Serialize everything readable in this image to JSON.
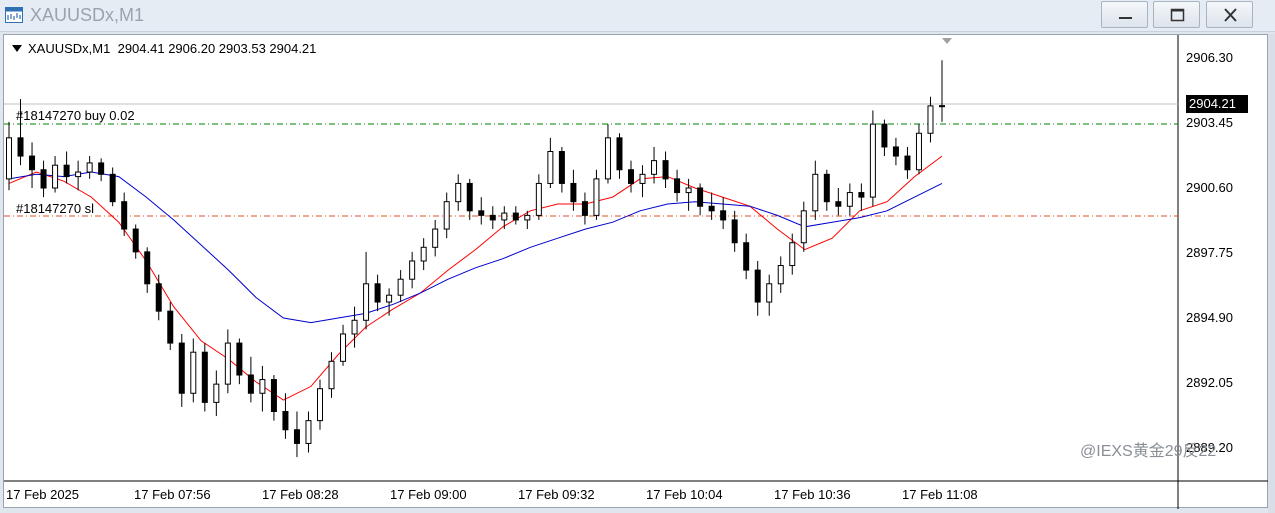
{
  "window": {
    "title": "XAUUSDx,M1",
    "app_icon": "chart-window-icon",
    "buttons": {
      "minimize": "minimize-icon",
      "maximize": "maximize-icon",
      "close": "close-icon"
    }
  },
  "header": {
    "symbol": "XAUUSDx,M1",
    "ohlc": "2904.41 2906.20 2903.53 2904.21"
  },
  "orders": {
    "buy": {
      "label": "#18147270 buy 0.02",
      "price": 2903.3,
      "color": "#008000"
    },
    "sl": {
      "label": "#18147270 sl",
      "price": 2899.0,
      "color": "#e0522a"
    }
  },
  "current_price": {
    "label": "2904.21",
    "value": 2904.21
  },
  "price_axis": [
    "2906.30",
    "2903.45",
    "2900.60",
    "2897.75",
    "2894.90",
    "2892.05",
    "2889.20"
  ],
  "time_axis": [
    "17 Feb 2025",
    "17 Feb 07:56",
    "17 Feb 08:28",
    "17 Feb 09:00",
    "17 Feb 09:32",
    "17 Feb 10:04",
    "17 Feb 10:36",
    "17 Feb 11:08"
  ],
  "watermark": "@IEXS黄金29反22",
  "colors": {
    "bull": "#ffffff",
    "bear": "#000000",
    "fast_ma": "#ff0000",
    "slow_ma": "#0000cc",
    "grid": "#c0c0c0"
  },
  "chart_data": {
    "type": "candlestick",
    "timeframe": "M1",
    "ylim": [
      2888.3,
      2907.2
    ],
    "moving_averages": [
      {
        "color": "#ff0000",
        "values": [
          2900.8,
          2901.3,
          2900.9,
          2900.2,
          2899.1,
          2897.4,
          2895.4,
          2893.9,
          2893.1,
          2892.1,
          2891.3,
          2891.9,
          2893.3,
          2894.5,
          2895.3,
          2896.0,
          2897.0,
          2897.9,
          2898.9,
          2899.6,
          2899.9,
          2899.9,
          2900.2,
          2901.0,
          2901.1,
          2900.6,
          2900.2,
          2899.8,
          2898.8,
          2897.9,
          2898.4,
          2899.6,
          2900.0,
          2901.1,
          2902.0
        ]
      },
      {
        "color": "#0000cc",
        "values": [
          2901.0,
          2901.2,
          2901.1,
          2901.3,
          2901.1,
          2900.2,
          2899.2,
          2898.1,
          2897.0,
          2895.8,
          2894.9,
          2894.7,
          2894.9,
          2895.1,
          2895.5,
          2896.0,
          2896.6,
          2897.1,
          2897.5,
          2898.0,
          2898.4,
          2898.8,
          2899.1,
          2899.6,
          2899.9,
          2900.0,
          2899.9,
          2899.8,
          2899.4,
          2898.9,
          2899.1,
          2899.3,
          2899.6,
          2900.2,
          2900.8
        ]
      }
    ],
    "candles": [
      [
        2901.0,
        2903.5,
        2900.5,
        2902.8
      ],
      [
        2902.8,
        2904.5,
        2901.6,
        2902.0
      ],
      [
        2902.0,
        2902.6,
        2900.6,
        2901.4
      ],
      [
        2901.4,
        2901.8,
        2900.2,
        2900.6
      ],
      [
        2900.6,
        2902.0,
        2900.4,
        2901.6
      ],
      [
        2901.6,
        2902.2,
        2900.8,
        2901.1
      ],
      [
        2901.1,
        2901.8,
        2900.5,
        2901.3
      ],
      [
        2901.3,
        2902.0,
        2901.0,
        2901.7
      ],
      [
        2901.7,
        2901.9,
        2900.9,
        2901.2
      ],
      [
        2901.2,
        2901.5,
        2899.8,
        2900.0
      ],
      [
        2900.0,
        2900.4,
        2898.5,
        2898.8
      ],
      [
        2898.8,
        2899.0,
        2897.5,
        2897.8
      ],
      [
        2897.8,
        2898.0,
        2896.0,
        2896.4
      ],
      [
        2896.4,
        2896.8,
        2894.8,
        2895.2
      ],
      [
        2895.2,
        2895.6,
        2893.5,
        2893.8
      ],
      [
        2893.8,
        2894.2,
        2891.0,
        2891.6
      ],
      [
        2891.6,
        2894.0,
        2891.2,
        2893.4
      ],
      [
        2893.4,
        2893.8,
        2890.8,
        2891.2
      ],
      [
        2891.2,
        2892.6,
        2890.6,
        2892.0
      ],
      [
        2892.0,
        2894.4,
        2891.6,
        2893.8
      ],
      [
        2893.8,
        2894.0,
        2892.0,
        2892.4
      ],
      [
        2892.4,
        2893.2,
        2891.2,
        2891.6
      ],
      [
        2891.6,
        2892.8,
        2890.8,
        2892.2
      ],
      [
        2892.2,
        2892.4,
        2890.4,
        2890.8
      ],
      [
        2890.8,
        2891.6,
        2889.6,
        2890.0
      ],
      [
        2890.0,
        2890.8,
        2888.8,
        2889.4
      ],
      [
        2889.4,
        2890.8,
        2889.0,
        2890.4
      ],
      [
        2890.4,
        2892.2,
        2890.0,
        2891.8
      ],
      [
        2891.8,
        2893.4,
        2891.4,
        2893.0
      ],
      [
        2893.0,
        2894.6,
        2892.8,
        2894.2
      ],
      [
        2894.2,
        2895.4,
        2893.6,
        2894.8
      ],
      [
        2894.8,
        2897.8,
        2894.4,
        2896.4
      ],
      [
        2896.4,
        2896.8,
        2895.2,
        2895.6
      ],
      [
        2895.6,
        2896.2,
        2895.0,
        2895.9
      ],
      [
        2895.9,
        2897.0,
        2895.6,
        2896.6
      ],
      [
        2896.6,
        2897.8,
        2896.2,
        2897.4
      ],
      [
        2897.4,
        2898.4,
        2897.0,
        2898.0
      ],
      [
        2898.0,
        2899.2,
        2897.6,
        2898.8
      ],
      [
        2898.8,
        2900.4,
        2898.4,
        2900.0
      ],
      [
        2900.0,
        2901.2,
        2899.6,
        2900.8
      ],
      [
        2900.8,
        2901.0,
        2899.2,
        2899.6
      ],
      [
        2899.6,
        2900.2,
        2899.0,
        2899.4
      ],
      [
        2899.4,
        2899.8,
        2898.8,
        2899.2
      ],
      [
        2899.2,
        2899.8,
        2898.8,
        2899.5
      ],
      [
        2899.5,
        2899.8,
        2899.0,
        2899.2
      ],
      [
        2899.2,
        2899.6,
        2898.8,
        2899.4
      ],
      [
        2899.4,
        2901.2,
        2899.2,
        2900.8
      ],
      [
        2900.8,
        2902.8,
        2900.6,
        2902.2
      ],
      [
        2902.2,
        2902.4,
        2900.4,
        2900.8
      ],
      [
        2900.8,
        2901.4,
        2899.6,
        2900.0
      ],
      [
        2900.0,
        2900.4,
        2899.0,
        2899.4
      ],
      [
        2899.4,
        2901.4,
        2899.2,
        2901.0
      ],
      [
        2901.0,
        2903.4,
        2900.8,
        2902.8
      ],
      [
        2902.8,
        2903.0,
        2901.0,
        2901.4
      ],
      [
        2901.4,
        2901.8,
        2900.4,
        2900.8
      ],
      [
        2900.8,
        2901.6,
        2900.2,
        2901.2
      ],
      [
        2901.2,
        2902.4,
        2900.8,
        2901.8
      ],
      [
        2901.8,
        2902.2,
        2900.6,
        2901.0
      ],
      [
        2901.0,
        2901.4,
        2900.0,
        2900.4
      ],
      [
        2900.4,
        2901.0,
        2899.6,
        2900.6
      ],
      [
        2900.6,
        2900.8,
        2899.4,
        2899.8
      ],
      [
        2899.8,
        2900.4,
        2899.2,
        2899.6
      ],
      [
        2899.6,
        2900.2,
        2898.8,
        2899.2
      ],
      [
        2899.2,
        2899.6,
        2897.8,
        2898.2
      ],
      [
        2898.2,
        2898.6,
        2896.6,
        2897.0
      ],
      [
        2897.0,
        2897.4,
        2895.0,
        2895.6
      ],
      [
        2895.6,
        2896.8,
        2895.0,
        2896.4
      ],
      [
        2896.4,
        2897.6,
        2896.0,
        2897.2
      ],
      [
        2897.2,
        2898.6,
        2896.8,
        2898.2
      ],
      [
        2898.2,
        2900.0,
        2897.8,
        2899.6
      ],
      [
        2899.6,
        2901.8,
        2899.2,
        2901.2
      ],
      [
        2901.2,
        2901.4,
        2899.6,
        2900.0
      ],
      [
        2900.0,
        2900.6,
        2899.4,
        2899.8
      ],
      [
        2899.8,
        2900.8,
        2899.4,
        2900.4
      ],
      [
        2900.4,
        2900.8,
        2899.6,
        2900.2
      ],
      [
        2900.2,
        2904.0,
        2899.8,
        2903.4
      ],
      [
        2903.4,
        2903.6,
        2902.0,
        2902.4
      ],
      [
        2902.4,
        2902.8,
        2901.6,
        2902.0
      ],
      [
        2902.0,
        2902.4,
        2901.0,
        2901.4
      ],
      [
        2901.4,
        2903.4,
        2901.2,
        2903.0
      ],
      [
        2903.0,
        2904.6,
        2902.6,
        2904.2
      ],
      [
        2904.2,
        2906.2,
        2903.5,
        2904.21
      ]
    ]
  }
}
